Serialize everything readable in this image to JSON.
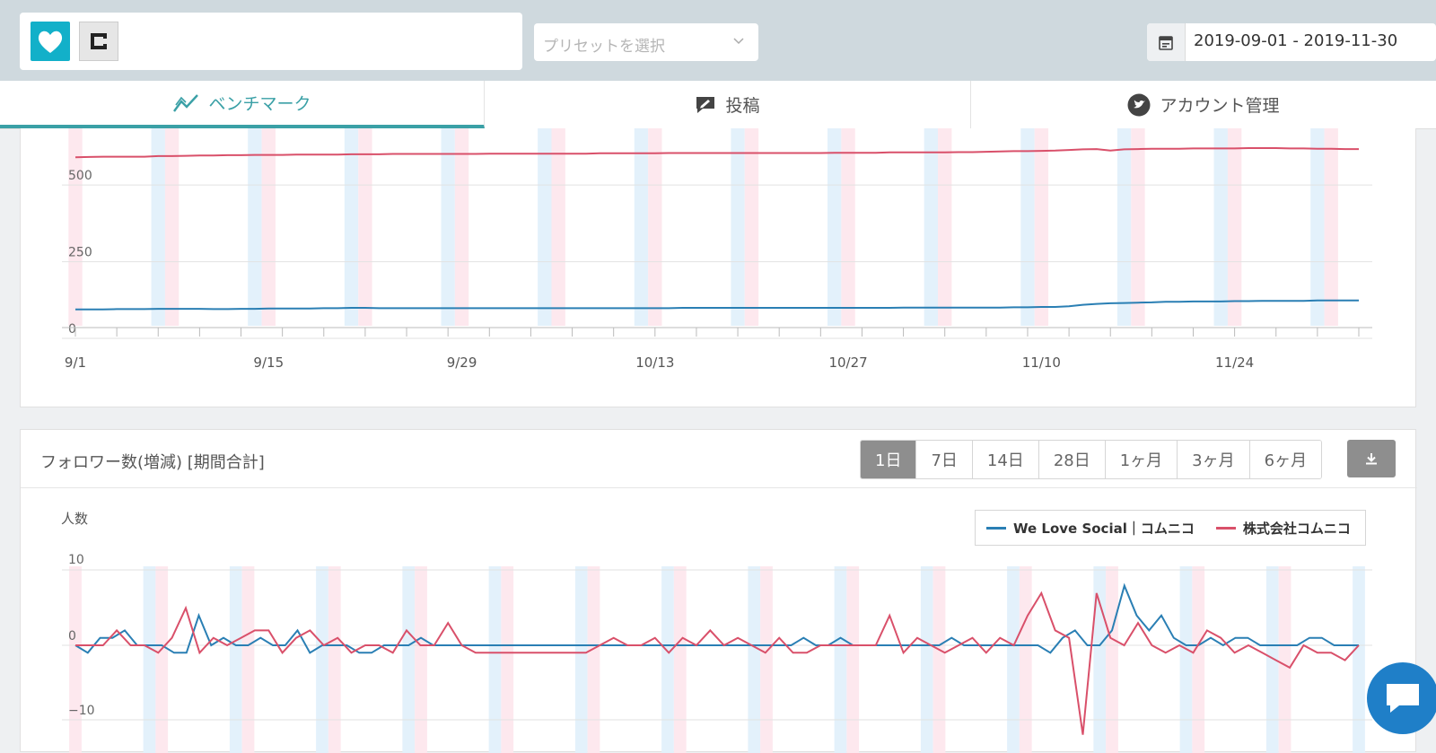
{
  "header": {
    "account_icons": [
      "heart-icon",
      "company-logo"
    ],
    "preset_placeholder": "プリセットを選択",
    "date_range": "2019-09-01  -  2019-11-30"
  },
  "tabs": [
    {
      "label": "ベンチマーク",
      "icon": "trend-icon",
      "active": true
    },
    {
      "label": "投稿",
      "icon": "edit-icon",
      "active": false
    },
    {
      "label": "アカウント管理",
      "icon": "twitter-icon",
      "active": false
    }
  ],
  "colors": {
    "series_blue": "#2a7fb4",
    "series_red": "#d9506a",
    "accent": "#3aa0a6"
  },
  "followers_section": {
    "title": "フォロワー数(増減) [期間合計]",
    "ranges": [
      "1日",
      "7日",
      "14日",
      "28日",
      "1ヶ月",
      "3ヶ月",
      "6ヶ月"
    ],
    "active_range": "1日",
    "download_icon": "download-icon",
    "y_unit": "人数",
    "legend": [
      "We Love Social｜コムニコ",
      "株式会社コムニコ"
    ]
  },
  "chart_data": [
    {
      "type": "line",
      "x_ticks": [
        "9/1",
        "9/15",
        "9/29",
        "10/13",
        "10/27",
        "11/10",
        "11/24"
      ],
      "y_ticks": [
        "500",
        "250",
        "0"
      ],
      "ylim": [
        0,
        600
      ],
      "series": [
        {
          "name": "株式会社コムニコ",
          "color": "#d9506a",
          "values": [
            526,
            527,
            528,
            528,
            528,
            528,
            530,
            530,
            531,
            532,
            532,
            533,
            533,
            534,
            534,
            534,
            535,
            535,
            535,
            535,
            536,
            536,
            536,
            537,
            537,
            537,
            537,
            537,
            537,
            537,
            538,
            538,
            538,
            538,
            538,
            538,
            538,
            538,
            539,
            539,
            539,
            539,
            539,
            540,
            540,
            540,
            540,
            540,
            540,
            540,
            540,
            540,
            540,
            540,
            540,
            541,
            541,
            541,
            541,
            542,
            542,
            542,
            542,
            542,
            543,
            543,
            544,
            545,
            546,
            546,
            547,
            548,
            550,
            552,
            553,
            548,
            552,
            553,
            554,
            554,
            554,
            555,
            555,
            555,
            555,
            556,
            556,
            556,
            555,
            555,
            554,
            554,
            553,
            553
          ]
        },
        {
          "name": "We Love Social｜コムニコ",
          "color": "#2a7fb4",
          "values": [
            30,
            30,
            30,
            31,
            31,
            31,
            32,
            32,
            32,
            32,
            31,
            31,
            32,
            32,
            33,
            33,
            33,
            33,
            34,
            34,
            35,
            35,
            34,
            34,
            34,
            34,
            34,
            34,
            34,
            34,
            34,
            34,
            34,
            34,
            34,
            34,
            34,
            34,
            34,
            34,
            34,
            34,
            34,
            34,
            35,
            35,
            35,
            35,
            35,
            35,
            35,
            35,
            35,
            35,
            35,
            35,
            35,
            35,
            35,
            35,
            36,
            36,
            36,
            36,
            36,
            36,
            36,
            36,
            37,
            37,
            38,
            38,
            40,
            45,
            48,
            50,
            51,
            52,
            53,
            55,
            55,
            56,
            56,
            56,
            57,
            57,
            58,
            58,
            58,
            58,
            59,
            59,
            59,
            59
          ]
        }
      ]
    },
    {
      "type": "line",
      "y_ticks": [
        "10",
        "0",
        "−10"
      ],
      "ylim": [
        -13,
        11
      ],
      "series": [
        {
          "name": "We Love Social｜コムニコ",
          "color": "#2a7fb4",
          "values": [
            0,
            -1,
            1,
            1,
            2,
            0,
            0,
            0,
            -1,
            -1,
            4,
            0,
            1,
            0,
            0,
            1,
            0,
            0,
            2,
            -1,
            0,
            0,
            0,
            -1,
            -1,
            0,
            0,
            0,
            1,
            0,
            0,
            0,
            0,
            0,
            0,
            0,
            0,
            0,
            0,
            0,
            0,
            0,
            0,
            0,
            0,
            0,
            0,
            0,
            0,
            0,
            0,
            0,
            0,
            0,
            0,
            0,
            0,
            0,
            0,
            1,
            0,
            0,
            1,
            0,
            0,
            0,
            0,
            0,
            0,
            0,
            0,
            1,
            0,
            0,
            0,
            0,
            0,
            0,
            0,
            -1,
            1,
            2,
            0,
            0,
            2,
            8,
            4,
            2,
            4,
            1,
            0,
            0,
            1,
            0,
            1,
            1,
            0,
            0,
            0,
            0,
            1,
            1,
            0,
            0,
            0
          ]
        },
        {
          "name": "株式会社コムニコ",
          "color": "#d9506a",
          "values": [
            0,
            0,
            0,
            2,
            0,
            0,
            -1,
            1,
            5,
            -1,
            1,
            0,
            1,
            2,
            2,
            -1,
            1,
            2,
            0,
            1,
            -1,
            0,
            0,
            -1,
            2,
            0,
            0,
            3,
            0,
            -1,
            -1,
            -1,
            -1,
            -1,
            -1,
            -1,
            -1,
            -1,
            0,
            1,
            0,
            0,
            1,
            -1,
            1,
            0,
            2,
            0,
            1,
            0,
            -1,
            1,
            -1,
            -1,
            0,
            0,
            0,
            0,
            0,
            4,
            -1,
            1,
            0,
            -1,
            0,
            1,
            -1,
            1,
            0,
            4,
            7,
            2,
            1,
            -12,
            7,
            1,
            0,
            3,
            0,
            -1,
            0,
            -1,
            2,
            1,
            -1,
            0,
            -1,
            -2,
            -3,
            0,
            -1,
            -1,
            -2,
            0
          ]
        }
      ]
    }
  ]
}
